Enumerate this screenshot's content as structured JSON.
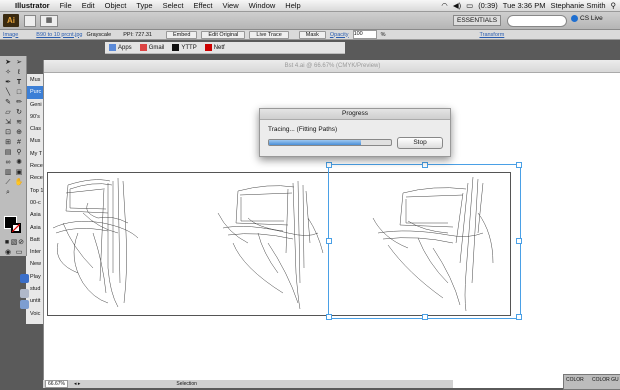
{
  "menubar": {
    "items": [
      "Illustrator",
      "File",
      "Edit",
      "Object",
      "Type",
      "Select",
      "Effect",
      "View",
      "Window",
      "Help"
    ],
    "battery": "(0:39)",
    "clock": "Tue 3:36 PM",
    "user": "Stephanie Smith"
  },
  "appbar": {
    "logo": "Ai",
    "workspace": "ESSENTIALS",
    "cs_live": "CS Live"
  },
  "control": {
    "image_link": "Image",
    "file_name": "B90 to 10 prcnt.jpg",
    "mode": "Grayscale",
    "ppi": "PPI: 727.31",
    "embed": "Embed",
    "edit_original": "Edit Original",
    "live_trace": "Live Trace",
    "mask": "Mask",
    "opacity_label": "Opacity",
    "opacity_value": "100",
    "opacity_unit": "%",
    "transform": "Transform"
  },
  "bookmarks": [
    "Apps",
    "Gmail",
    "YTTP",
    "Netf"
  ],
  "sidelist": [
    "Mus",
    "Purc",
    "Geni",
    "90's",
    "Clas",
    "Mus",
    "My T",
    "Rece",
    "Rece",
    "Top 1",
    "00-c",
    "Asia",
    "Asia",
    "Batt",
    "Inter",
    "New",
    "Play",
    "stud",
    "untit",
    "Voic"
  ],
  "sidelist_selected": 1,
  "doc_title": "Bst 4.ai @ 66.67% (CMYK/Preview)",
  "dialog": {
    "title": "Progress",
    "status": "Tracing... (Fitting Paths)",
    "progress": 0.75,
    "stop_label": "Stop"
  },
  "statusbar": {
    "zoom": "66.67%",
    "selection": "Selection"
  },
  "colorpanel": {
    "tab1": "COLOR",
    "tab2": "COLOR GU"
  },
  "colors": {
    "accent": "#4aa0e6",
    "selected_row": "#3c7fd6"
  }
}
